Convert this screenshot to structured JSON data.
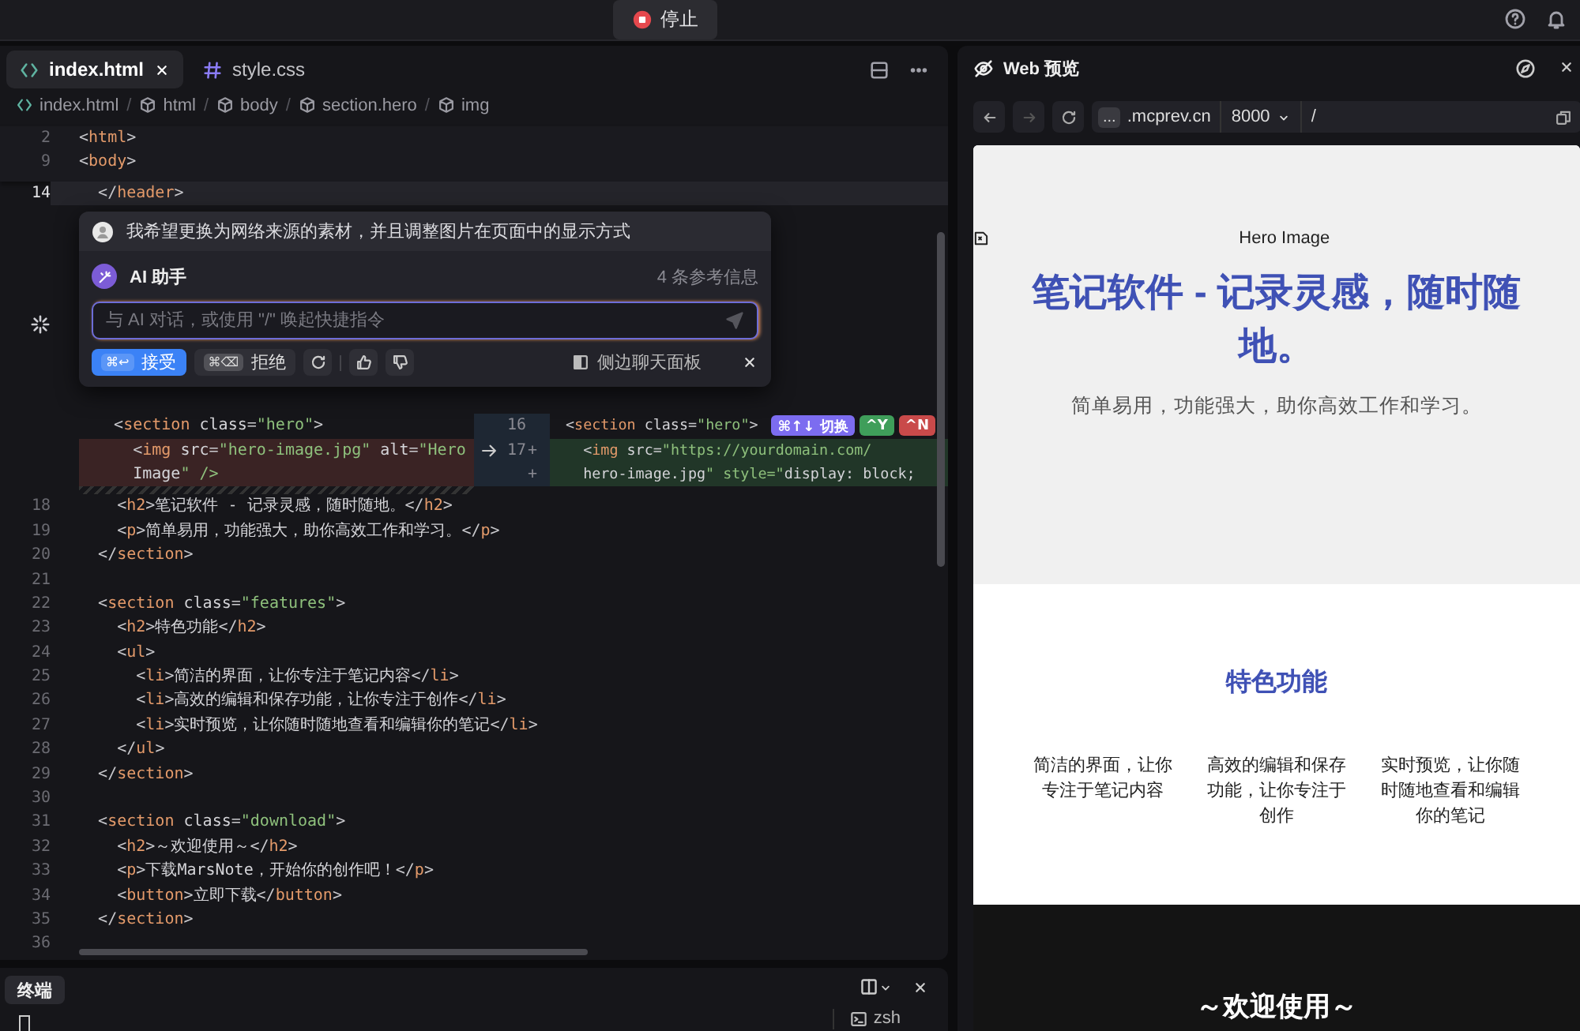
{
  "toolbar": {
    "stop_button": "停止"
  },
  "editor": {
    "tabs": [
      {
        "label": "index.html",
        "kind": "html",
        "selected": true
      },
      {
        "label": "style.css",
        "kind": "css",
        "selected": false
      }
    ],
    "breadcrumb": [
      {
        "label": "index.html",
        "kind": "file"
      },
      {
        "label": "html",
        "kind": "element"
      },
      {
        "label": "body",
        "kind": "element"
      },
      {
        "label": "section.hero",
        "kind": "element"
      },
      {
        "label": "img",
        "kind": "element"
      }
    ],
    "breadcrumb_separator": "/",
    "sticky_lines": [
      {
        "number": "2",
        "text": "<html>"
      },
      {
        "number": "9",
        "text": "<body>"
      }
    ],
    "lines_before": [
      {
        "number": "14",
        "text": "  </header>",
        "current": true
      }
    ],
    "ai_chat": {
      "user_message": "我希望更换为网络来源的素材，并且调整图片在页面中的显示方式",
      "assistant": "AI 助手",
      "references": "4 条参考信息",
      "input_placeholder": "与 AI 对话，或使用 \"/\" 唤起快捷指令",
      "accept": {
        "shortcut": "⌘↩",
        "label": "接受"
      },
      "reject": {
        "shortcut": "⌘⌫",
        "label": "拒绝"
      },
      "side_panel": "侧边聊天面板"
    },
    "diff": {
      "old_lines": [
        {
          "kind": "context",
          "text": "  <section class=\"hero\">"
        },
        {
          "kind": "removed",
          "text": "    <img src=\"hero-image.jpg\" alt=\"Hero"
        },
        {
          "kind": "removed",
          "text": "    Image\" />"
        }
      ],
      "new_lines": [
        {
          "kind": "context",
          "number": "16",
          "text": "<section class=\"hero\">"
        },
        {
          "kind": "added",
          "number": "17",
          "marker": "+",
          "text": "  <img src=\"https://yourdomain.com/"
        },
        {
          "kind": "added",
          "marker": "+",
          "text": "  hero-image.jpg\" style=\"display: block;"
        }
      ],
      "switch": {
        "shortcut": "⌘↑↓",
        "label": "切换"
      },
      "accept_key": "^Y",
      "reject_key": "^N"
    },
    "lines": [
      {
        "number": "18",
        "text": "    <h2>笔记软件 - 记录灵感，随时随地。</h2>"
      },
      {
        "number": "19",
        "text": "    <p>简单易用，功能强大，助你高效工作和学习。</p>"
      },
      {
        "number": "20",
        "text": "  </section>"
      },
      {
        "number": "21"
      },
      {
        "number": "22",
        "text": "  <section class=\"features\">"
      },
      {
        "number": "23",
        "text": "    <h2>特色功能</h2>"
      },
      {
        "number": "24",
        "text": "    <ul>"
      },
      {
        "number": "25",
        "text": "      <li>简洁的界面，让你专注于笔记内容</li>"
      },
      {
        "number": "26",
        "text": "      <li>高效的编辑和保存功能，让你专注于创作</li>"
      },
      {
        "number": "27",
        "text": "      <li>实时预览，让你随时随地查看和编辑你的笔记</li>"
      },
      {
        "number": "28",
        "text": "    </ul>"
      },
      {
        "number": "29",
        "text": "  </section>"
      },
      {
        "number": "30"
      },
      {
        "number": "31",
        "text": "  <section class=\"download\">"
      },
      {
        "number": "32",
        "text": "    <h2>～欢迎使用～</h2>"
      },
      {
        "number": "33",
        "text": "    <p>下载MarsNote，开始你的创作吧！</p>"
      },
      {
        "number": "34",
        "text": "    <button>立即下载</button>"
      },
      {
        "number": "35",
        "text": "  </section>"
      },
      {
        "number": "36"
      }
    ]
  },
  "terminal": {
    "tab": "终端",
    "sessions": [
      {
        "label": "zsh"
      }
    ]
  },
  "preview": {
    "title": "Web 预览",
    "url": {
      "host_prefix": "...",
      "host": ".mcprev.cn",
      "port": "8000",
      "path": "/"
    },
    "page": {
      "hero_image_alt": "Hero Image",
      "hero_title": "笔记软件 - 记录灵感，随时随地。",
      "hero_text": "简单易用，功能强大，助你高效工作和学习。",
      "features_title": "特色功能",
      "features": [
        "简洁的界面，让你专注于笔记内容",
        "高效的编辑和保存功能，让你专注于创作",
        "实时预览，让你随时随地查看和编辑你的笔记"
      ],
      "download_title": "～欢迎使用～"
    }
  }
}
